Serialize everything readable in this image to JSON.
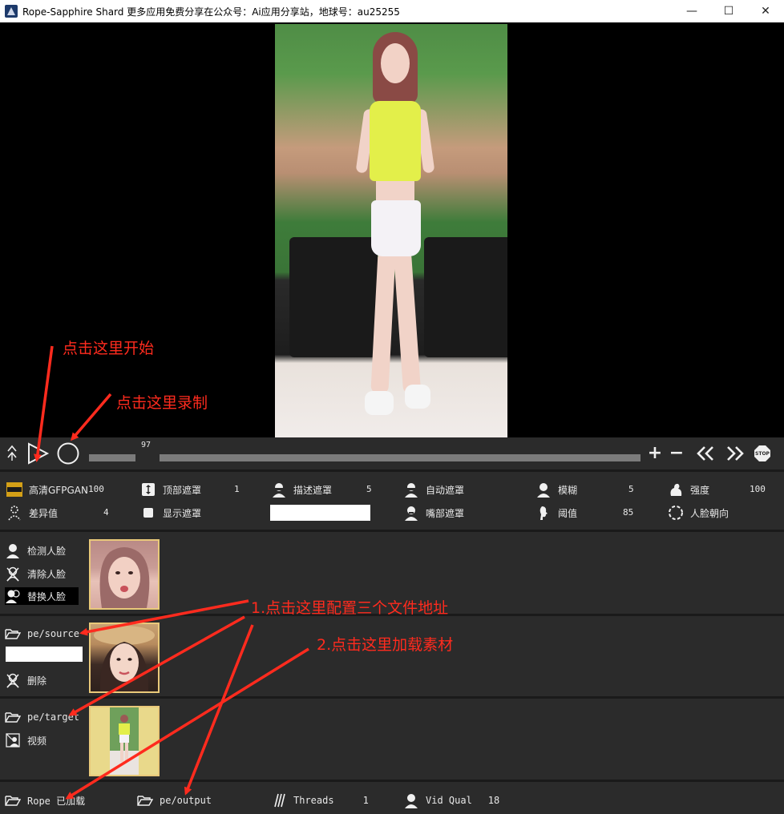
{
  "window": {
    "title": "Rope-Sapphire Shard 更多应用免费分享在公众号：Ai应用分享站，地球号：au25255",
    "minimize": "—",
    "maximize": "☐",
    "close": "✕"
  },
  "annotations": {
    "start": "点击这里开始",
    "record": "点击这里录制",
    "config_paths": "1.点击这里配置三个文件地址",
    "load_assets": "2.点击这里加载素材"
  },
  "transport": {
    "frame_number": "97",
    "play_icon": "play-icon",
    "record_icon": "record-icon",
    "stop_label": "STOP"
  },
  "params": {
    "row1": [
      {
        "label": "高清GFPGAN",
        "value": "100",
        "icon": "gfpgan-icon"
      },
      {
        "label": "顶部遮罩",
        "value": "1",
        "icon": "vertical-resize-icon"
      },
      {
        "label": "描述遮罩",
        "value": "5",
        "icon": "face-mask-icon"
      },
      {
        "label": "自动遮罩",
        "value": "",
        "icon": "face-mask-icon"
      },
      {
        "label": "模糊",
        "value": "5",
        "icon": "face-icon"
      },
      {
        "label": "强度",
        "value": "100",
        "icon": "strength-icon"
      }
    ],
    "row2": [
      {
        "label": "差异值",
        "value": "4",
        "icon": "diff-icon"
      },
      {
        "label": "显示遮罩",
        "value": "",
        "icon": "square-icon"
      },
      {
        "label": "嘴部遮罩",
        "value": "",
        "icon": "face-mask-icon"
      },
      {
        "label": "阈值",
        "value": "85",
        "icon": "profile-icon"
      },
      {
        "label": "人脸朝向",
        "value": "",
        "icon": "dashed-circle-icon"
      }
    ]
  },
  "faces": {
    "detect": "检测人脸",
    "clear": "清除人脸",
    "swap": "替换人脸"
  },
  "source": {
    "folder_label": "pe/source",
    "delete": "删除"
  },
  "target": {
    "folder_label": "pe/target",
    "video": "视频"
  },
  "bottom": {
    "rope_label": "Rope 已加载",
    "output_label": "pe/output",
    "threads_label": "Threads",
    "threads_value": "1",
    "vidqual_label": "Vid Qual",
    "vidqual_value": "18"
  },
  "colors": {
    "annotation": "#ff2b1e",
    "panel_bg": "#2b2b2b",
    "thumb_border": "#e9c97a"
  }
}
